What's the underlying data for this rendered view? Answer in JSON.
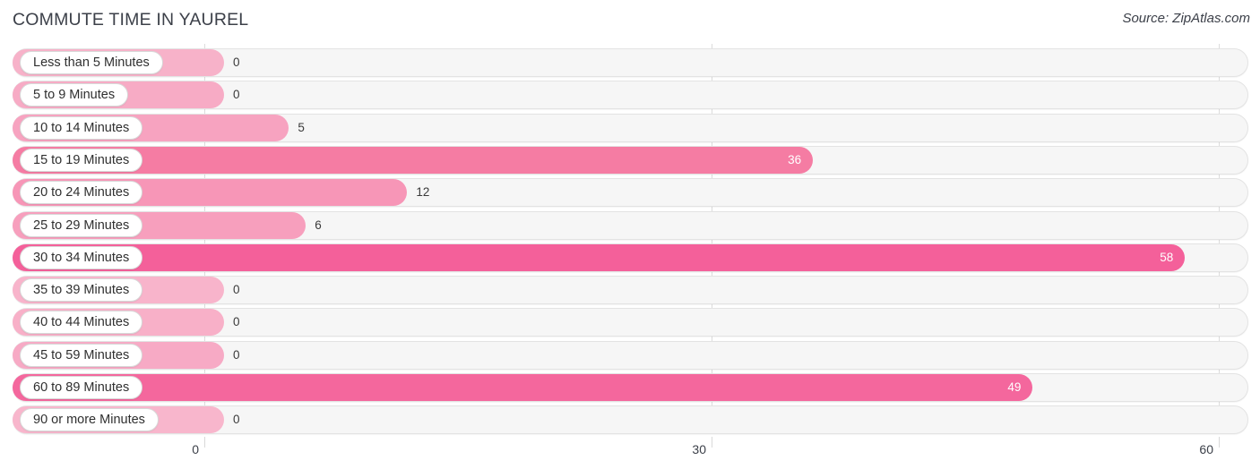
{
  "header": {
    "title": "COMMUTE TIME IN YAUREL",
    "source": "Source: ZipAtlas.com"
  },
  "chart_data": {
    "type": "bar",
    "orientation": "horizontal",
    "title": "COMMUTE TIME IN YAUREL",
    "subtitle": "Source: ZipAtlas.com",
    "xlabel": "",
    "ylabel": "",
    "xlim": [
      0,
      60
    ],
    "grid": true,
    "legend": null,
    "x_ticks": [
      "0",
      "30",
      "60"
    ],
    "x_tick_values": [
      0,
      30,
      60
    ],
    "categories": [
      "Less than 5 Minutes",
      "5 to 9 Minutes",
      "10 to 14 Minutes",
      "15 to 19 Minutes",
      "20 to 24 Minutes",
      "25 to 29 Minutes",
      "30 to 34 Minutes",
      "35 to 39 Minutes",
      "40 to 44 Minutes",
      "45 to 59 Minutes",
      "60 to 89 Minutes",
      "90 or more Minutes"
    ],
    "values": [
      0,
      0,
      5,
      36,
      12,
      6,
      58,
      0,
      0,
      0,
      49,
      0
    ],
    "value_labels": [
      "0",
      "0",
      "5",
      "36",
      "12",
      "6",
      "58",
      "0",
      "0",
      "0",
      "49",
      "0"
    ]
  },
  "colors": {
    "bar_light": "#f6a4c0",
    "bar_medium": "#f57ca3",
    "bar_strong": "#f4609a",
    "track_fill": "#f6f6f6",
    "track_border": "#e3e3e3",
    "gridline": "#dcdcdc",
    "text_dark": "#3c4049",
    "value_inside": "#ffffff"
  },
  "rows": [
    {
      "label": "Less than 5 Minutes",
      "value": 0,
      "value_label": "0",
      "color": "#f7b2c9",
      "inside": false
    },
    {
      "label": "5 to 9 Minutes",
      "value": 0,
      "value_label": "0",
      "color": "#f7abc5",
      "inside": false
    },
    {
      "label": "10 to 14 Minutes",
      "value": 5,
      "value_label": "5",
      "color": "#f7a3c0",
      "inside": false
    },
    {
      "label": "15 to 19 Minutes",
      "value": 36,
      "value_label": "36",
      "color": "#f57ca3",
      "inside": true
    },
    {
      "label": "20 to 24 Minutes",
      "value": 12,
      "value_label": "12",
      "color": "#f796b7",
      "inside": false
    },
    {
      "label": "25 to 29 Minutes",
      "value": 6,
      "value_label": "6",
      "color": "#f79fbd",
      "inside": false
    },
    {
      "label": "30 to 34 Minutes",
      "value": 58,
      "value_label": "58",
      "color": "#f4609a",
      "inside": true
    },
    {
      "label": "35 to 39 Minutes",
      "value": 0,
      "value_label": "0",
      "color": "#f8b4cb",
      "inside": false
    },
    {
      "label": "40 to 44 Minutes",
      "value": 0,
      "value_label": "0",
      "color": "#f8b0c8",
      "inside": false
    },
    {
      "label": "45 to 59 Minutes",
      "value": 0,
      "value_label": "0",
      "color": "#f7aac5",
      "inside": false
    },
    {
      "label": "60 to 89 Minutes",
      "value": 49,
      "value_label": "49",
      "color": "#f4679d",
      "inside": true
    },
    {
      "label": "90 or more Minutes",
      "value": 0,
      "value_label": "0",
      "color": "#f8b6cc",
      "inside": false
    }
  ],
  "axis": {
    "ticks": [
      {
        "label": "0",
        "value": 0
      },
      {
        "label": "30",
        "value": 30
      },
      {
        "label": "60",
        "value": 60
      }
    ]
  }
}
